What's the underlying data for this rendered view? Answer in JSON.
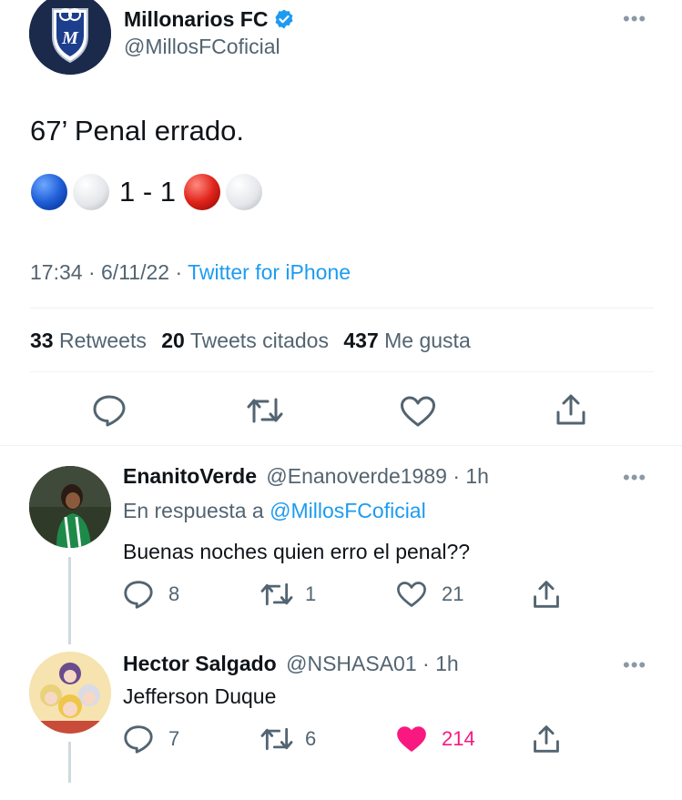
{
  "main_tweet": {
    "author_name": "Millonarios FC",
    "author_handle": "@MillosFCoficial",
    "text_line1": "67’ Penal errado.",
    "score": "1 - 1",
    "time": "17:34",
    "date": "6/11/22",
    "source": "Twitter for iPhone",
    "retweets_count": "33",
    "retweets_label": "Retweets",
    "quotes_count": "20",
    "quotes_label": "Tweets citados",
    "likes_count": "437",
    "likes_label": "Me gusta"
  },
  "replies": [
    {
      "name": "EnanitoVerde",
      "handle": "@Enanoverde1989",
      "time": "1h",
      "reply_to_prefix": "En respuesta a",
      "reply_to_handle": "@MillosFCoficial",
      "text": "Buenas noches quien erro el penal??",
      "reply_count": "8",
      "retweet_count": "1",
      "like_count": "21"
    },
    {
      "name": "Hector Salgado",
      "handle": "@NSHASA01",
      "time": "1h",
      "text": "Jefferson Duque",
      "reply_count": "7",
      "retweet_count": "6",
      "like_count": "214",
      "liked": true
    }
  ],
  "colors": {
    "accent": "#1d9bf0",
    "like_active": "#f91880",
    "muted_text": "#536471",
    "icon": "#536471"
  }
}
